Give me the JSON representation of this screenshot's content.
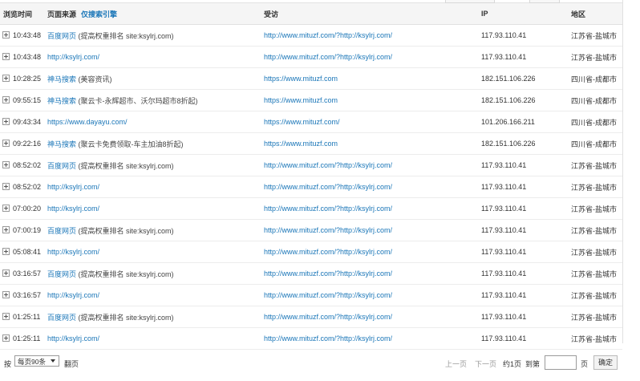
{
  "table": {
    "headers": {
      "time": "浏览时间",
      "source": "页面来源",
      "search_only": "仅搜索引擎",
      "visited": "受访",
      "ip": "IP",
      "region": "地区"
    },
    "rows": [
      {
        "time": "10:43:48",
        "source_link": "百度网页",
        "source_kw": "(提高权重排名 site:ksylrj.com)",
        "visited": "http://www.mituzf.com/?http://ksylrj.com/",
        "ip": "117.93.110.41",
        "region": "江苏省-盐城市"
      },
      {
        "time": "10:43:48",
        "source_link": "http://ksylrj.com/",
        "source_kw": "",
        "visited": "http://www.mituzf.com/?http://ksylrj.com/",
        "ip": "117.93.110.41",
        "region": "江苏省-盐城市"
      },
      {
        "time": "10:28:25",
        "source_link": "神马搜索",
        "source_kw": "(美容资讯)",
        "visited": "https://www.mituzf.com",
        "ip": "182.151.106.226",
        "region": "四川省-成都市"
      },
      {
        "time": "09:55:15",
        "source_link": "神马搜索",
        "source_kw": "(聚云卡-永辉超市、沃尔玛超市8折起)",
        "visited": "https://www.mituzf.com",
        "ip": "182.151.106.226",
        "region": "四川省-成都市"
      },
      {
        "time": "09:43:34",
        "source_link": "https://www.dayayu.com/",
        "source_kw": "",
        "visited": "https://www.mituzf.com/",
        "ip": "101.206.166.211",
        "region": "四川省-成都市"
      },
      {
        "time": "09:22:16",
        "source_link": "神马搜索",
        "source_kw": "(聚云卡免费领取-车主加油8折起)",
        "visited": "https://www.mituzf.com",
        "ip": "182.151.106.226",
        "region": "四川省-成都市"
      },
      {
        "time": "08:52:02",
        "source_link": "百度网页",
        "source_kw": "(提高权重排名 site:ksylrj.com)",
        "visited": "http://www.mituzf.com/?http://ksylrj.com/",
        "ip": "117.93.110.41",
        "region": "江苏省-盐城市"
      },
      {
        "time": "08:52:02",
        "source_link": "http://ksylrj.com/",
        "source_kw": "",
        "visited": "http://www.mituzf.com/?http://ksylrj.com/",
        "ip": "117.93.110.41",
        "region": "江苏省-盐城市"
      },
      {
        "time": "07:00:20",
        "source_link": "http://ksylrj.com/",
        "source_kw": "",
        "visited": "http://www.mituzf.com/?http://ksylrj.com/",
        "ip": "117.93.110.41",
        "region": "江苏省-盐城市"
      },
      {
        "time": "07:00:19",
        "source_link": "百度网页",
        "source_kw": "(提高权重排名 site:ksylrj.com)",
        "visited": "http://www.mituzf.com/?http://ksylrj.com/",
        "ip": "117.93.110.41",
        "region": "江苏省-盐城市"
      },
      {
        "time": "05:08:41",
        "source_link": "http://ksylrj.com/",
        "source_kw": "",
        "visited": "http://www.mituzf.com/?http://ksylrj.com/",
        "ip": "117.93.110.41",
        "region": "江苏省-盐城市"
      },
      {
        "time": "03:16:57",
        "source_link": "百度网页",
        "source_kw": "(提高权重排名 site:ksylrj.com)",
        "visited": "http://www.mituzf.com/?http://ksylrj.com/",
        "ip": "117.93.110.41",
        "region": "江苏省-盐城市"
      },
      {
        "time": "03:16:57",
        "source_link": "http://ksylrj.com/",
        "source_kw": "",
        "visited": "http://www.mituzf.com/?http://ksylrj.com/",
        "ip": "117.93.110.41",
        "region": "江苏省-盐城市"
      },
      {
        "time": "01:25:11",
        "source_link": "百度网页",
        "source_kw": "(提高权重排名 site:ksylrj.com)",
        "visited": "http://www.mituzf.com/?http://ksylrj.com/",
        "ip": "117.93.110.41",
        "region": "江苏省-盐城市"
      },
      {
        "time": "01:25:11",
        "source_link": "http://ksylrj.com/",
        "source_kw": "",
        "visited": "http://www.mituzf.com/?http://ksylrj.com/",
        "ip": "117.93.110.41",
        "region": "江苏省-盐城市"
      }
    ]
  },
  "footer": {
    "by_label": "按",
    "page_size": "每页90条",
    "page_unit": "翻页",
    "prev": "上一页",
    "next": "下一页",
    "total_pages": "约1页",
    "goto": "到第",
    "page_suffix": "页",
    "confirm": "确定"
  },
  "colors": {
    "link": "#1a76b8",
    "header_bg": "#f5f5f5",
    "border": "#e1e1e1"
  }
}
